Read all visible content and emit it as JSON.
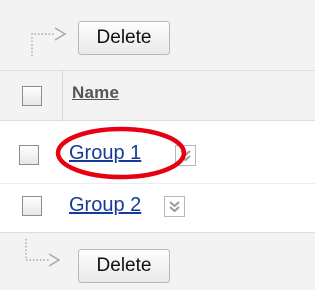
{
  "toolbar": {
    "delete_label": "Delete"
  },
  "table": {
    "columns": {
      "name": "Name"
    },
    "rows": [
      {
        "name": "Group 1"
      },
      {
        "name": "Group 2"
      }
    ]
  },
  "icons": {
    "selection_arrow": "dotted-down-right-arrow-icon",
    "row_menu": "double-chevron-down-icon",
    "highlight": "red-circle-annotation"
  },
  "colors": {
    "toolbar_background": "#f3f3f3",
    "link": "#163a9c",
    "annotation": "#e60012"
  }
}
